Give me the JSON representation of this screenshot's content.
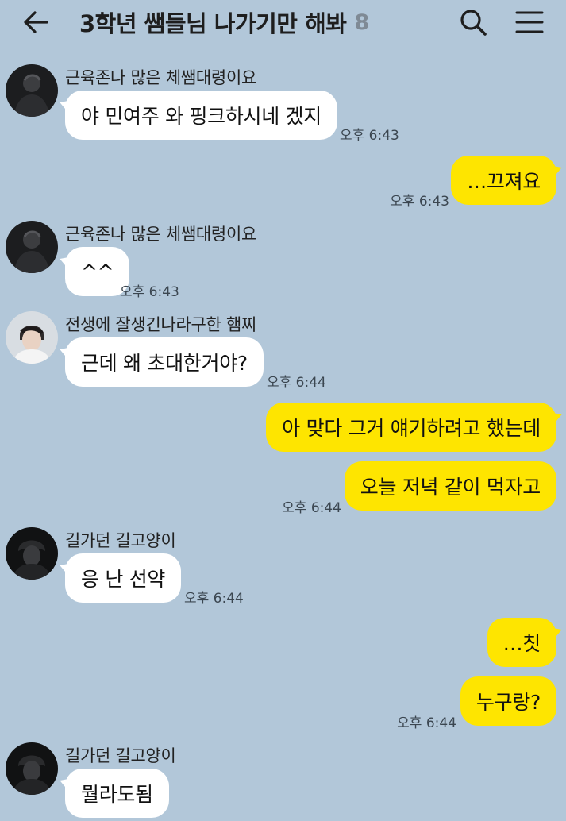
{
  "header": {
    "title": "3학년 쌤들님 나가기만 해봐",
    "member_count": "8"
  },
  "messages": {
    "m1": {
      "sender": "근육존나 많은 체쌤대령이요",
      "text": "야 민여주 와 핑크하시네 겠지",
      "time": "오후 6:43"
    },
    "m2": {
      "text": "…끄져요",
      "time": "오후 6:43"
    },
    "m3": {
      "sender": "근육존나 많은 체쌤대령이요",
      "text": "^^",
      "time": "오후 6:43"
    },
    "m4": {
      "sender": "전생에 잘생긴나라구한 햄찌",
      "text": "근데 왜 초대한거야?",
      "time": "오후 6:44"
    },
    "m5": {
      "text": "아 맞다 그거 얘기하려고 했는데"
    },
    "m6": {
      "text": "오늘 저녁 같이 먹자고",
      "time": "오후 6:44"
    },
    "m7": {
      "sender": "길가던 길고양이",
      "text": "응 난 선약",
      "time": "오후 6:44"
    },
    "m8": {
      "text": "…칫"
    },
    "m9": {
      "text": "누구랑?",
      "time": "오후 6:44"
    },
    "m10": {
      "sender": "길가던 길고양이",
      "text": "뭘라도됨"
    }
  },
  "colors": {
    "background": "#b2c7d9",
    "my_bubble": "#fee500",
    "other_bubble": "#ffffff",
    "member_count": "#7f8a95"
  },
  "icons": {
    "back": "arrow-left-icon",
    "search": "search-icon",
    "menu": "hamburger-menu-icon"
  }
}
